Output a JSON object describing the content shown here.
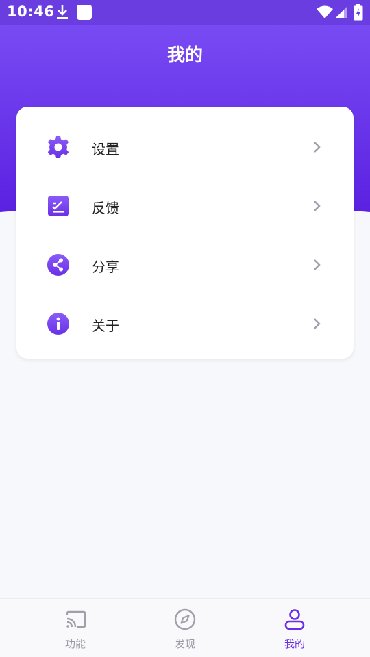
{
  "status_bar": {
    "time": "10:46",
    "icons": [
      "download-icon",
      "app-notification-icon",
      "wifi-icon",
      "signal-icon",
      "battery-charging-icon"
    ]
  },
  "header": {
    "title": "我的"
  },
  "menu": {
    "items": [
      {
        "label": "设置",
        "icon": "gear-icon"
      },
      {
        "label": "反馈",
        "icon": "feedback-icon"
      },
      {
        "label": "分享",
        "icon": "share-icon"
      },
      {
        "label": "关于",
        "icon": "info-icon"
      }
    ]
  },
  "bottom_nav": {
    "tabs": [
      {
        "label": "功能",
        "icon": "cast-icon",
        "active": false
      },
      {
        "label": "发现",
        "icon": "compass-icon",
        "active": false
      },
      {
        "label": "我的",
        "icon": "user-icon",
        "active": true
      }
    ]
  },
  "colors": {
    "accent": "#6b2ee6",
    "header_top": "#7c50f6",
    "header_bottom": "#5a1fe0",
    "inactive": "#9a9aa6"
  }
}
